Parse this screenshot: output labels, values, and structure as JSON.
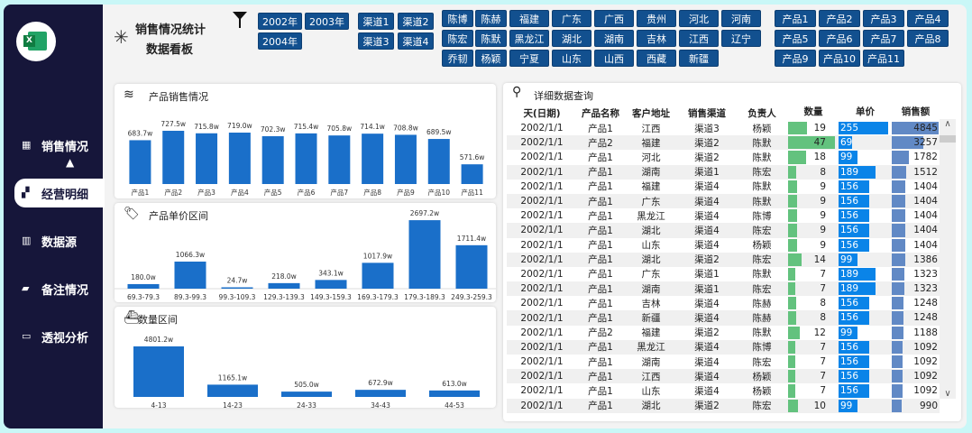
{
  "header": {
    "title_line1": "销售情况统计",
    "title_line2": "数据看板"
  },
  "sidebar": {
    "items": [
      {
        "label": "销售情况",
        "icon": "grid-icon"
      },
      {
        "label": "经营明细",
        "icon": "blocks-icon",
        "active": true
      },
      {
        "label": "数据源",
        "icon": "bar-chart-icon"
      },
      {
        "label": "备注情况",
        "icon": "comment-icon"
      },
      {
        "label": "透视分析",
        "icon": "card-icon"
      }
    ]
  },
  "slicers": {
    "years": [
      "2002年",
      "2003年",
      "2004年"
    ],
    "channels": [
      "渠道1",
      "渠道2",
      "渠道3",
      "渠道4"
    ],
    "persons": [
      "陈博",
      "陈赫",
      "陈宏",
      "陈默",
      "乔韧",
      "杨颖"
    ],
    "regions": [
      "福建",
      "广东",
      "广西",
      "贵州",
      "河北",
      "河南",
      "黑龙江",
      "湖北",
      "湖南",
      "吉林",
      "江西",
      "辽宁",
      "宁夏",
      "山东",
      "山西",
      "西藏",
      "新疆"
    ],
    "products": [
      "产品1",
      "产品2",
      "产品3",
      "产品4",
      "产品5",
      "产品6",
      "产品7",
      "产品8",
      "产品9",
      "产品10",
      "产品11"
    ]
  },
  "colors": {
    "sidebar": "#16163a",
    "slicer": "#12508f",
    "bar": "#1a6fc9",
    "qty_bar": "#63c27e",
    "price_bar": "#0a84e8",
    "amount_bar": "#6189c5"
  },
  "chart_data": [
    {
      "type": "bar",
      "title": "产品销售情况",
      "categories": [
        "产品1",
        "产品2",
        "产品3",
        "产品4",
        "产品5",
        "产品6",
        "产品7",
        "产品8",
        "产品9",
        "产品10",
        "产品11"
      ],
      "values": [
        683.7,
        727.5,
        715.8,
        719.0,
        702.3,
        715.4,
        705.8,
        714.1,
        708.8,
        689.5,
        571.6
      ],
      "labels": [
        "683.7w",
        "727.5w",
        "715.8w",
        "719.0w",
        "702.3w",
        "715.4w",
        "705.8w",
        "714.1w",
        "708.8w",
        "689.5w",
        "571.6w"
      ],
      "ylim": [
        480,
        740
      ]
    },
    {
      "type": "bar",
      "title": "产品单价区间",
      "categories": [
        "69.3-79.3",
        "89.3-99.3",
        "99.3-109.3",
        "129.3-139.3",
        "149.3-159.3",
        "169.3-179.3",
        "179.3-189.3",
        "249.3-259.3"
      ],
      "values": [
        180.0,
        1066.3,
        24.7,
        218.0,
        343.1,
        1017.9,
        2697.2,
        1711.4
      ],
      "labels": [
        "180.0w",
        "1066.3w",
        "24.7w",
        "218.0w",
        "343.1w",
        "1017.9w",
        "2697.2w",
        "1711.4w"
      ],
      "ylim": [
        0,
        2700
      ]
    },
    {
      "type": "bar",
      "title": "数量区间",
      "categories": [
        "4-13",
        "14-23",
        "24-33",
        "34-43",
        "44-53"
      ],
      "values": [
        4801.2,
        1165.1,
        505.0,
        672.9,
        613.0
      ],
      "labels": [
        "4801.2w",
        "1165.1w",
        "505.0w",
        "672.9w",
        "613.0w"
      ],
      "ylim": [
        0,
        4801.2
      ]
    }
  ],
  "table": {
    "title": "详细数据查询",
    "columns": [
      "天(日期)",
      "产品名称",
      "客户地址",
      "销售渠道",
      "负责人",
      "数量",
      "单价",
      "销售额"
    ],
    "rows": [
      [
        "2002/1/1",
        "产品1",
        "江西",
        "渠道3",
        "杨颖",
        19,
        255,
        4845
      ],
      [
        "2002/1/1",
        "产品2",
        "福建",
        "渠道2",
        "陈默",
        47,
        69,
        3257
      ],
      [
        "2002/1/1",
        "产品1",
        "河北",
        "渠道2",
        "陈默",
        18,
        99,
        1782
      ],
      [
        "2002/1/1",
        "产品1",
        "湖南",
        "渠道1",
        "陈宏",
        8,
        189,
        1512
      ],
      [
        "2002/1/1",
        "产品1",
        "福建",
        "渠道4",
        "陈默",
        9,
        156,
        1404
      ],
      [
        "2002/1/1",
        "产品1",
        "广东",
        "渠道4",
        "陈默",
        9,
        156,
        1404
      ],
      [
        "2002/1/1",
        "产品1",
        "黑龙江",
        "渠道4",
        "陈博",
        9,
        156,
        1404
      ],
      [
        "2002/1/1",
        "产品1",
        "湖北",
        "渠道4",
        "陈宏",
        9,
        156,
        1404
      ],
      [
        "2002/1/1",
        "产品1",
        "山东",
        "渠道4",
        "杨颖",
        9,
        156,
        1404
      ],
      [
        "2002/1/1",
        "产品1",
        "湖北",
        "渠道2",
        "陈宏",
        14,
        99,
        1386
      ],
      [
        "2002/1/1",
        "产品1",
        "广东",
        "渠道1",
        "陈默",
        7,
        189,
        1323
      ],
      [
        "2002/1/1",
        "产品1",
        "湖南",
        "渠道1",
        "陈宏",
        7,
        189,
        1323
      ],
      [
        "2002/1/1",
        "产品1",
        "吉林",
        "渠道4",
        "陈赫",
        8,
        156,
        1248
      ],
      [
        "2002/1/1",
        "产品1",
        "新疆",
        "渠道4",
        "陈赫",
        8,
        156,
        1248
      ],
      [
        "2002/1/1",
        "产品2",
        "福建",
        "渠道2",
        "陈默",
        12,
        99,
        1188
      ],
      [
        "2002/1/1",
        "产品1",
        "黑龙江",
        "渠道4",
        "陈博",
        7,
        156,
        1092
      ],
      [
        "2002/1/1",
        "产品1",
        "湖南",
        "渠道4",
        "陈宏",
        7,
        156,
        1092
      ],
      [
        "2002/1/1",
        "产品1",
        "江西",
        "渠道4",
        "杨颖",
        7,
        156,
        1092
      ],
      [
        "2002/1/1",
        "产品1",
        "山东",
        "渠道4",
        "杨颖",
        7,
        156,
        1092
      ],
      [
        "2002/1/1",
        "产品1",
        "湖北",
        "渠道2",
        "陈宏",
        10,
        99,
        990
      ]
    ]
  }
}
